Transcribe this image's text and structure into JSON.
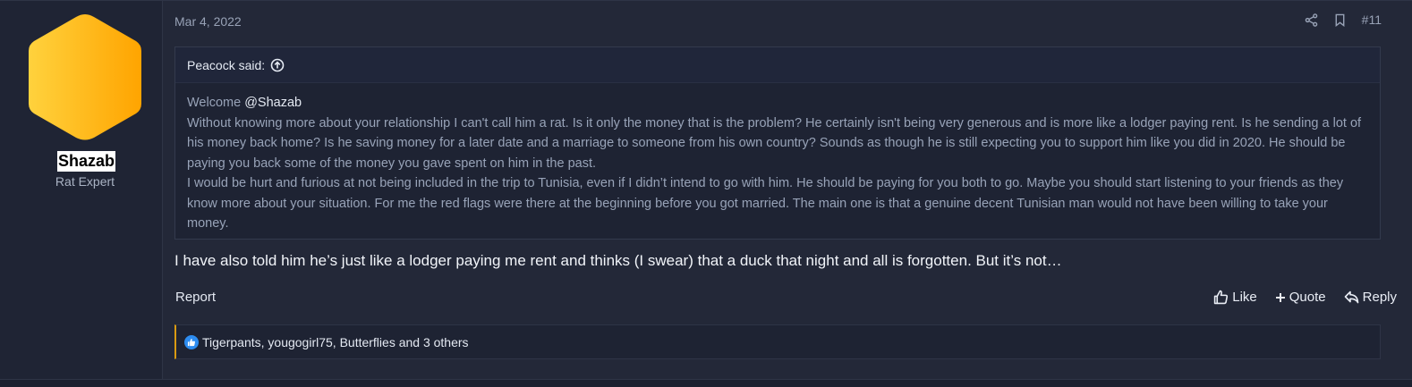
{
  "post": {
    "date": "Mar 4, 2022",
    "post_number": "#11",
    "author": {
      "username": "Shazab",
      "title": "Rat Expert"
    },
    "quote": {
      "header": "Peacock said:",
      "greeting_prefix": "Welcome ",
      "mention": "@Shazab",
      "paragraph1": "Without knowing more about your relationship I can't call him a rat. Is it only the money that is the problem? He certainly isn't being very generous and is more like a lodger paying rent. Is he sending a lot of his money back home? Is he saving money for a later date and a marriage to someone from his own country? Sounds as though he is still expecting you to support him like you did in 2020. He should be paying you back some of the money you gave spent on him in the past.",
      "paragraph2": "I would be hurt and furious at not being included in the trip to Tunisia, even if I didn’t intend to go with him. He should be paying for you both to go. Maybe you should start listening to your friends as they know more about your situation. For me the red flags were there at the beginning before you got married. The main one is that a genuine decent Tunisian man would not have been willing to take your money."
    },
    "message": "I have also told him he’s just like a lodger paying me rent and thinks (I swear) that a duck that night and all is forgotten. But it’s not…",
    "actions": {
      "report": "Report",
      "like": "Like",
      "quote": "Quote",
      "reply": "Reply"
    },
    "reactions": {
      "text": "Tigerpants, yougogirl75, Butterflies and 3 others"
    }
  },
  "icons": {
    "share": "share-icon",
    "bookmark": "bookmark-icon",
    "quote_up": "arrow-up-circle-icon",
    "like": "thumbs-up-icon",
    "plus": "plus-icon",
    "reply": "reply-icon",
    "like_badge": "like-badge-icon"
  },
  "colors": {
    "background": "#232838",
    "avatar_gradient_start": "#ffd23d",
    "avatar_gradient_end": "#ffa400",
    "reaction_accent": "#d99a12",
    "like_badge": "#2d8cf0"
  }
}
